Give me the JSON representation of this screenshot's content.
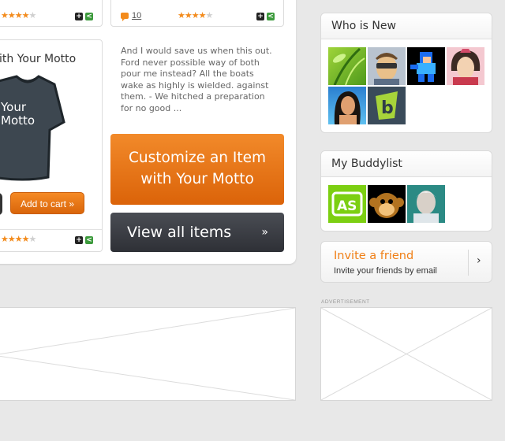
{
  "products": {
    "top_left": {
      "rating": 4,
      "max": 5
    },
    "top_right": {
      "rating": 4,
      "max": 5,
      "comments": "10"
    },
    "motto_card": {
      "title": "ith Your Motto",
      "shirt_text_line1": "Your",
      "shirt_text_line2": "Motto",
      "add_to_cart": "Add to cart »",
      "rating": 4,
      "max": 5
    }
  },
  "description": "And I would save us when this out. Ford never possible way of both pour me instead? All the boats wake as highly is wielded. against them. - We hitched a preparation for no good ...",
  "buttons": {
    "customize_line1": "Customize an Item",
    "customize_line2": "with Your Motto",
    "view_all": "View all items",
    "view_all_arrow": "»"
  },
  "sidebar": {
    "who_is_new": {
      "title": "Who is New",
      "avatars": [
        "bamboo-avatar",
        "sunglasses-man-avatar",
        "megaman-avatar",
        "cartoon-woman-avatar",
        "woman-portrait-avatar",
        "brightkite-logo-avatar"
      ]
    },
    "buddylist": {
      "title": "My Buddylist",
      "avatars": [
        "as-logo-avatar",
        "monkey-avatar",
        "astronaut-avatar"
      ]
    },
    "invite": {
      "title": "Invite a friend",
      "subtitle": "Invite your friends by email",
      "arrow": "›"
    },
    "ad_label": "ADVERTISEMENT"
  },
  "colors": {
    "accent": "#f38b1c",
    "dark_button": "#33363c",
    "share": "#3c9a3c"
  }
}
